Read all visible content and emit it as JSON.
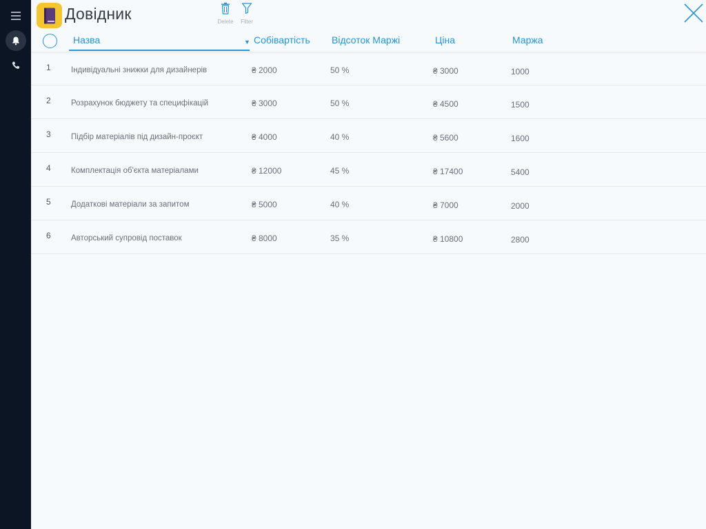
{
  "app": {
    "title": "Довідник"
  },
  "toolbar": {
    "delete_label": "Delete",
    "filter_label": "Filter"
  },
  "sidebar": {
    "icons": [
      "menu-icon",
      "bell-icon",
      "phone-icon"
    ]
  },
  "colors": {
    "accent": "#2793d4",
    "sidebar_bg": "#0c1524",
    "app_icon_bg": "#f2c531",
    "app_icon_book": "#5b3b78"
  },
  "table": {
    "columns": {
      "name": "Назва",
      "cost": "Собівартість",
      "margin_pct": "Відсоток Маржі",
      "price": "Ціна",
      "margin": "Маржа"
    },
    "sort": {
      "column": "cost",
      "direction": "desc"
    },
    "rows": [
      {
        "num": "1",
        "name": "Індивідуальні знижки для дизайнерів",
        "cost": "₴ 2000",
        "pct": "50 %",
        "price": "₴ 3000",
        "margin": "1000"
      },
      {
        "num": "2",
        "name": "Розрахунок бюджету та специфікацій",
        "cost": "₴ 3000",
        "pct": "50 %",
        "price": "₴ 4500",
        "margin": "1500"
      },
      {
        "num": "3",
        "name": "Підбір матеріалів під дизайн-проєкт",
        "cost": "₴ 4000",
        "pct": "40 %",
        "price": "₴ 5600",
        "margin": "1600"
      },
      {
        "num": "4",
        "name": "Комплектація об'єкта матеріалами",
        "cost": "₴ 12000",
        "pct": "45 %",
        "price": "₴ 17400",
        "margin": "5400"
      },
      {
        "num": "5",
        "name": "Додаткові матеріали за запитом",
        "cost": "₴ 5000",
        "pct": "40 %",
        "price": "₴ 7000",
        "margin": "2000"
      },
      {
        "num": "6",
        "name": "Авторський супровід поставок",
        "cost": "₴ 8000",
        "pct": "35 %",
        "price": "₴ 10800",
        "margin": "2800"
      }
    ]
  }
}
